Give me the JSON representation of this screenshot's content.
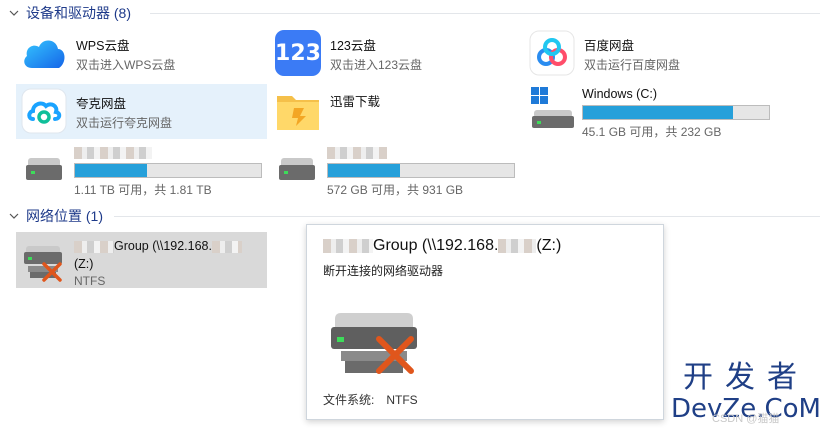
{
  "groups": {
    "devices": {
      "label": "设备和驱动器 (8)"
    },
    "network": {
      "label": "网络位置 (1)"
    }
  },
  "devices": {
    "wps": {
      "name": "WPS云盘",
      "sub": "双击进入WPS云盘"
    },
    "yun123": {
      "name": "123云盘",
      "sub": "双击进入123云盘",
      "icon_text": "123"
    },
    "baidu": {
      "name": "百度网盘",
      "sub": "双击运行百度网盘"
    },
    "quark": {
      "name": "夸克网盘",
      "sub": "双击运行夸克网盘"
    },
    "xunlei": {
      "name": "迅雷下载"
    },
    "windows": {
      "name": "Windows (C:)",
      "sub": "45.1 GB 可用，共 232 GB",
      "used_fraction": 0.806
    },
    "drive_a": {
      "sub": "1.11 TB 可用，共 1.81 TB",
      "used_fraction": 0.387
    },
    "drive_b": {
      "sub": "572 GB 可用，共 931 GB",
      "used_fraction": 0.386
    }
  },
  "network": {
    "drive": {
      "name_suffix": "Group (\\\\192.168.",
      "name_tail": "(Z:)",
      "sub": "NTFS"
    }
  },
  "popup": {
    "title_suffix": "Group (\\\\192.168.",
    "title_tail": "(Z:)",
    "description": "断开连接的网络驱动器",
    "fs_label": "文件系统:",
    "fs_value": "NTFS"
  },
  "watermark": {
    "line1": "开发者",
    "line2": "DevZe.CoM",
    "sub": "CSDN @猫猫"
  },
  "colors": {
    "group_header": "#1e3a8a",
    "bar_fill": "#26a0da",
    "selected_bg": "#e5f1fb",
    "hover_bg": "#d9d9d9",
    "error_x": "#e0561c"
  },
  "icons": {
    "wps": "cloud-icon",
    "yun123": "123-logo-icon",
    "baidu": "baidu-netdisk-icon",
    "quark": "quark-cloud-icon",
    "xunlei": "folder-thunder-icon",
    "windows": "windows-drive-icon",
    "disk": "hard-drive-icon",
    "network_disconnected": "network-drive-disconnected-icon"
  }
}
